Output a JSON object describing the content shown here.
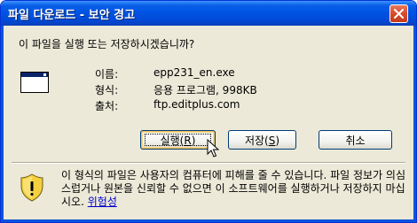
{
  "window": {
    "title": "파일 다운로드 - 보안 경고"
  },
  "dialog": {
    "question": "이 파일을 실행 또는 저장하시겠습니까?",
    "fields": [
      {
        "label": "이름:",
        "value": "epp231_en.exe"
      },
      {
        "label": "형식:",
        "value": "응용 프로그램, 998KB"
      },
      {
        "label": "출처:",
        "value": "ftp.editplus.com"
      }
    ]
  },
  "buttons": {
    "run": {
      "label": "실행(",
      "accel": "R",
      "suffix": ")"
    },
    "save": {
      "label": "저장(",
      "accel": "S",
      "suffix": ")"
    },
    "cancel": {
      "label": "취소"
    }
  },
  "warning": {
    "text": "이 형식의 파일은 사용자의 컴퓨터에 피해를 줄 수 있습니다. 파일 정보가 의심스럽거나 원본을 신뢰할 수 없으면 이 소프트웨어를 실행하거나 저장하지 마십시오.",
    "link": "위험성"
  },
  "icons": {
    "close": "close-icon",
    "file": "application-window-icon",
    "warning": "security-shield-icon",
    "cursor": "mouse-pointer-icon"
  },
  "colors": {
    "title_bar": "#0054e3",
    "dialog_bg": "#ece9d8",
    "link": "#0000cc",
    "shield_yellow": "#f4d03f"
  }
}
